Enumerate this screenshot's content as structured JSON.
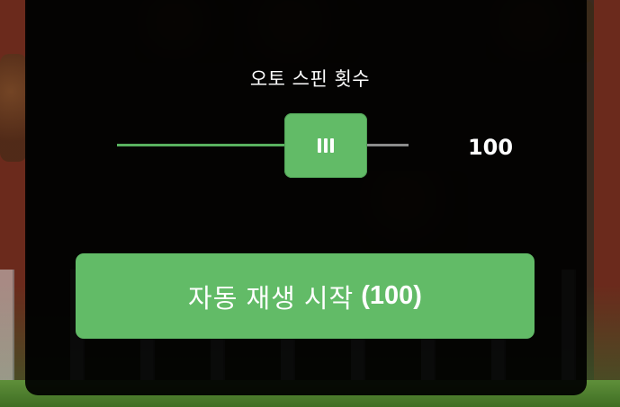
{
  "dialog": {
    "title": "오토 스핀 횟수",
    "spin_count": "100",
    "slider_fraction": 0.58,
    "accent_color": "#62bb67"
  },
  "start_button": {
    "label": "자동 재생 시작",
    "count": "(100)"
  },
  "icons": {
    "slider_grip": "grip-lines-icon"
  }
}
